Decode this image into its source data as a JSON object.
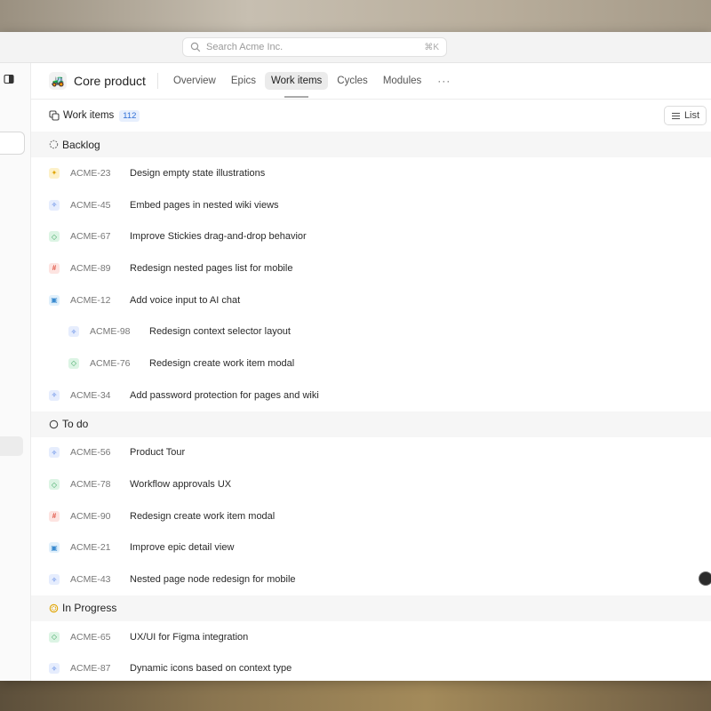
{
  "search": {
    "placeholder": "Search Acme Inc.",
    "shortcut": "⌘K"
  },
  "project": {
    "name": "Core product",
    "icon": "tractor-icon"
  },
  "tabs": [
    {
      "label": "Overview",
      "active": false
    },
    {
      "label": "Epics",
      "active": false
    },
    {
      "label": "Work items",
      "active": true
    },
    {
      "label": "Cycles",
      "active": false
    },
    {
      "label": "Modules",
      "active": false
    }
  ],
  "work_items": {
    "title": "Work items",
    "count": "112",
    "layout_label": "List"
  },
  "groups": [
    {
      "name": "Backlog",
      "icon": "dashed-circle-icon",
      "items": [
        {
          "id": "ACME-23",
          "title": "Design empty state illustrations",
          "type": "star",
          "sub": false
        },
        {
          "id": "ACME-45",
          "title": "Embed pages in nested wiki views",
          "type": "spark",
          "sub": false
        },
        {
          "id": "ACME-67",
          "title": "Improve Stickies drag-and-drop behavior",
          "type": "cube",
          "sub": false
        },
        {
          "id": "ACME-89",
          "title": "Redesign nested pages list for mobile",
          "type": "hash",
          "sub": false
        },
        {
          "id": "ACME-12",
          "title": "Add voice input to AI chat",
          "type": "layers",
          "sub": false
        },
        {
          "id": "ACME-98",
          "title": "Redesign context selector layout",
          "type": "spark",
          "sub": true
        },
        {
          "id": "ACME-76",
          "title": "Redesign create work item modal",
          "type": "cube",
          "sub": true
        },
        {
          "id": "ACME-34",
          "title": "Add password protection for pages and wiki",
          "type": "spark",
          "sub": false
        }
      ]
    },
    {
      "name": "To do",
      "icon": "circle-icon",
      "items": [
        {
          "id": "ACME-56",
          "title": "Product Tour",
          "type": "spark",
          "sub": false
        },
        {
          "id": "ACME-78",
          "title": "Workflow approvals UX",
          "type": "cube",
          "sub": false
        },
        {
          "id": "ACME-90",
          "title": "Redesign create work item modal",
          "type": "hash",
          "sub": false
        },
        {
          "id": "ACME-21",
          "title": "Improve epic detail view",
          "type": "layers",
          "sub": false
        },
        {
          "id": "ACME-43",
          "title": "Nested page node redesign for mobile",
          "type": "spark",
          "sub": false
        }
      ]
    },
    {
      "name": "In Progress",
      "icon": "in-progress-circle-icon",
      "items": [
        {
          "id": "ACME-65",
          "title": "UX/UI for Figma integration",
          "type": "cube",
          "sub": false
        },
        {
          "id": "ACME-87",
          "title": "Dynamic icons based on context type",
          "type": "spark",
          "sub": false
        }
      ]
    }
  ],
  "colors": {
    "accent": "#2f6fd6",
    "in_progress": "#e0a400"
  }
}
